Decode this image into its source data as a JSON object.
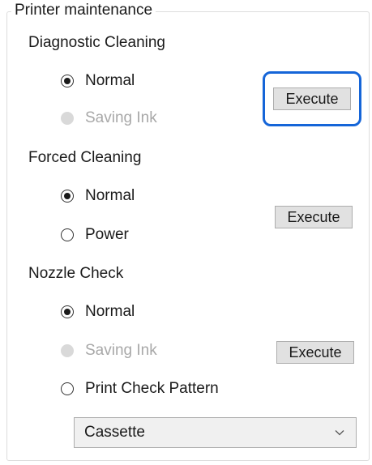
{
  "group": {
    "legend": "Printer maintenance"
  },
  "diagnostic": {
    "title": "Diagnostic Cleaning",
    "options": [
      "Normal",
      "Saving Ink"
    ],
    "button": "Execute"
  },
  "forced": {
    "title": "Forced Cleaning",
    "options": [
      "Normal",
      "Power"
    ],
    "button": "Execute"
  },
  "nozzle": {
    "title": "Nozzle Check",
    "options": [
      "Normal",
      "Saving Ink",
      "Print Check Pattern"
    ],
    "button": "Execute",
    "select_value": "Cassette"
  },
  "colors": {
    "focus_ring": "#1565d8",
    "button_bg": "#e1e1e1",
    "disabled_text": "#a8a8a8"
  },
  "icons": {
    "dropdown": "chevron-down-icon"
  }
}
